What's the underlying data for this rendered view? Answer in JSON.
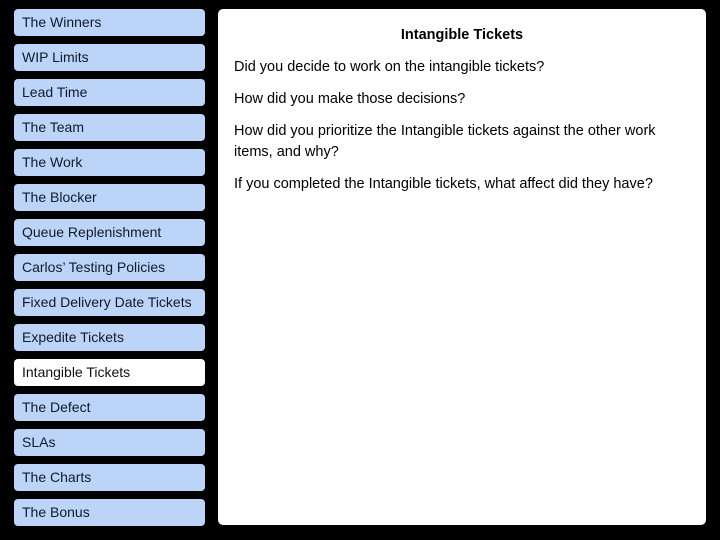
{
  "sidebar": {
    "items": [
      {
        "label": "The Winners",
        "active": false
      },
      {
        "label": "WIP Limits",
        "active": false
      },
      {
        "label": "Lead Time",
        "active": false
      },
      {
        "label": "The Team",
        "active": false
      },
      {
        "label": "The Work",
        "active": false
      },
      {
        "label": "The Blocker",
        "active": false
      },
      {
        "label": "Queue Replenishment",
        "active": false
      },
      {
        "label": "Carlos’ Testing Policies",
        "active": false
      },
      {
        "label": "Fixed Delivery Date Tickets",
        "active": false
      },
      {
        "label": "Expedite Tickets",
        "active": false
      },
      {
        "label": "Intangible Tickets",
        "active": true
      },
      {
        "label": "The Defect",
        "active": false
      },
      {
        "label": "SLAs",
        "active": false
      },
      {
        "label": "The Charts",
        "active": false
      },
      {
        "label": "The Bonus",
        "active": false
      }
    ]
  },
  "main": {
    "title": "Intangible Tickets",
    "questions": [
      "Did you decide to work on the intangible tickets?",
      "How did you make those decisions?",
      "How did you prioritize the Intangible tickets against the other work items, and why?",
      "If you completed the Intangible tickets, what affect did they have?"
    ]
  },
  "colors": {
    "background": "#000000",
    "nav_item": "#bcd4f8",
    "nav_item_active": "#ffffff",
    "panel": "#ffffff"
  }
}
